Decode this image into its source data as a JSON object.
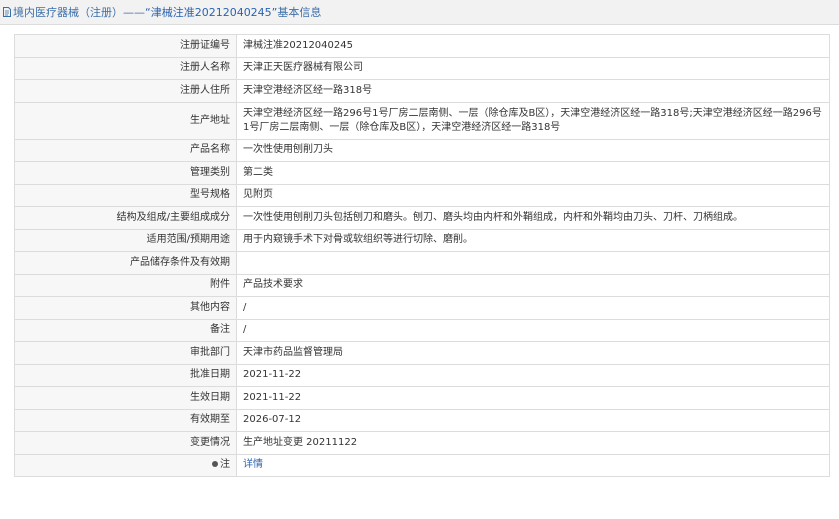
{
  "header": {
    "category": "境内医疗器械（注册）",
    "separator": " —— ",
    "highlight": "“津械注准20212040245”",
    "suffix": " 基本信息"
  },
  "rows": [
    {
      "label": "注册证编号",
      "value": "津械注准20212040245"
    },
    {
      "label": "注册人名称",
      "value": "天津正天医疗器械有限公司"
    },
    {
      "label": "注册人住所",
      "value": "天津空港经济区经一路318号"
    },
    {
      "label": "生产地址",
      "value": "天津空港经济区经一路296号1号厂房二层南侧、一层（除仓库及B区），天津空港经济区经一路318号;天津空港经济区经一路296号1号厂房二层南侧、一层（除仓库及B区），天津空港经济区经一路318号"
    },
    {
      "label": "产品名称",
      "value": "一次性使用刨削刀头"
    },
    {
      "label": "管理类别",
      "value": "第二类"
    },
    {
      "label": "型号规格",
      "value": "见附页"
    },
    {
      "label": "结构及组成/主要组成成分",
      "value": "一次性使用刨削刀头包括刨刀和磨头。刨刀、磨头均由内杆和外鞘组成，内杆和外鞘均由刀头、刀杆、刀柄组成。"
    },
    {
      "label": "适用范围/预期用途",
      "value": "用于内窥镜手术下对骨或软组织等进行切除、磨削。"
    },
    {
      "label": "产品储存条件及有效期",
      "value": ""
    },
    {
      "label": "附件",
      "value": "产品技术要求"
    },
    {
      "label": "其他内容",
      "value": "/"
    },
    {
      "label": "备注",
      "value": "/"
    },
    {
      "label": "审批部门",
      "value": "天津市药品监督管理局"
    },
    {
      "label": "批准日期",
      "value": "2021-11-22"
    },
    {
      "label": "生效日期",
      "value": "2021-11-22"
    },
    {
      "label": "有效期至",
      "value": "2026-07-12"
    },
    {
      "label": "变更情况",
      "value": "生产地址变更 20211122"
    }
  ],
  "note": {
    "label": "注",
    "link": "详情"
  }
}
